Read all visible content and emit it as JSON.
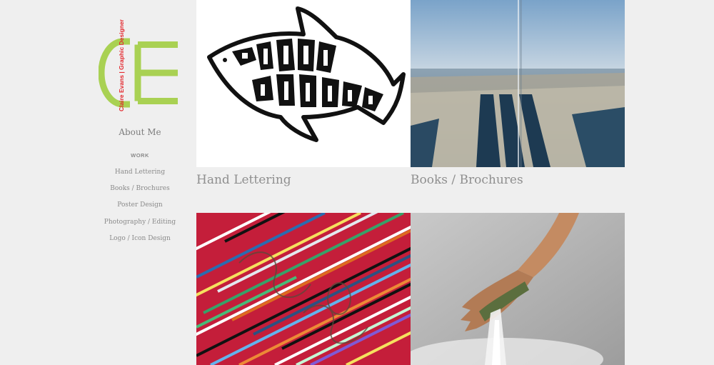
{
  "brand": {
    "logo_letters": "CE",
    "tagline": "Claire Evans | Graphic Designer",
    "accent_color": "#a9d153",
    "tagline_color": "#e3262c"
  },
  "sidebar": {
    "about_label": "About Me",
    "work_heading": "WORK",
    "items": [
      {
        "label": "Hand Lettering"
      },
      {
        "label": "Books / Brochures"
      },
      {
        "label": "Poster Design"
      },
      {
        "label": "Photography / Editing"
      },
      {
        "label": "Logo / Icon Design"
      }
    ]
  },
  "portfolio": [
    {
      "caption": "Hand Lettering",
      "image_icon": "shark-attack-lettering-image"
    },
    {
      "caption": "Books / Brochures",
      "image_icon": "ocean-garbage-photo-image"
    },
    {
      "caption": "",
      "image_icon": "glitch-stripes-poster-image"
    },
    {
      "caption": "",
      "image_icon": "hand-waterfall-photo-image"
    }
  ]
}
